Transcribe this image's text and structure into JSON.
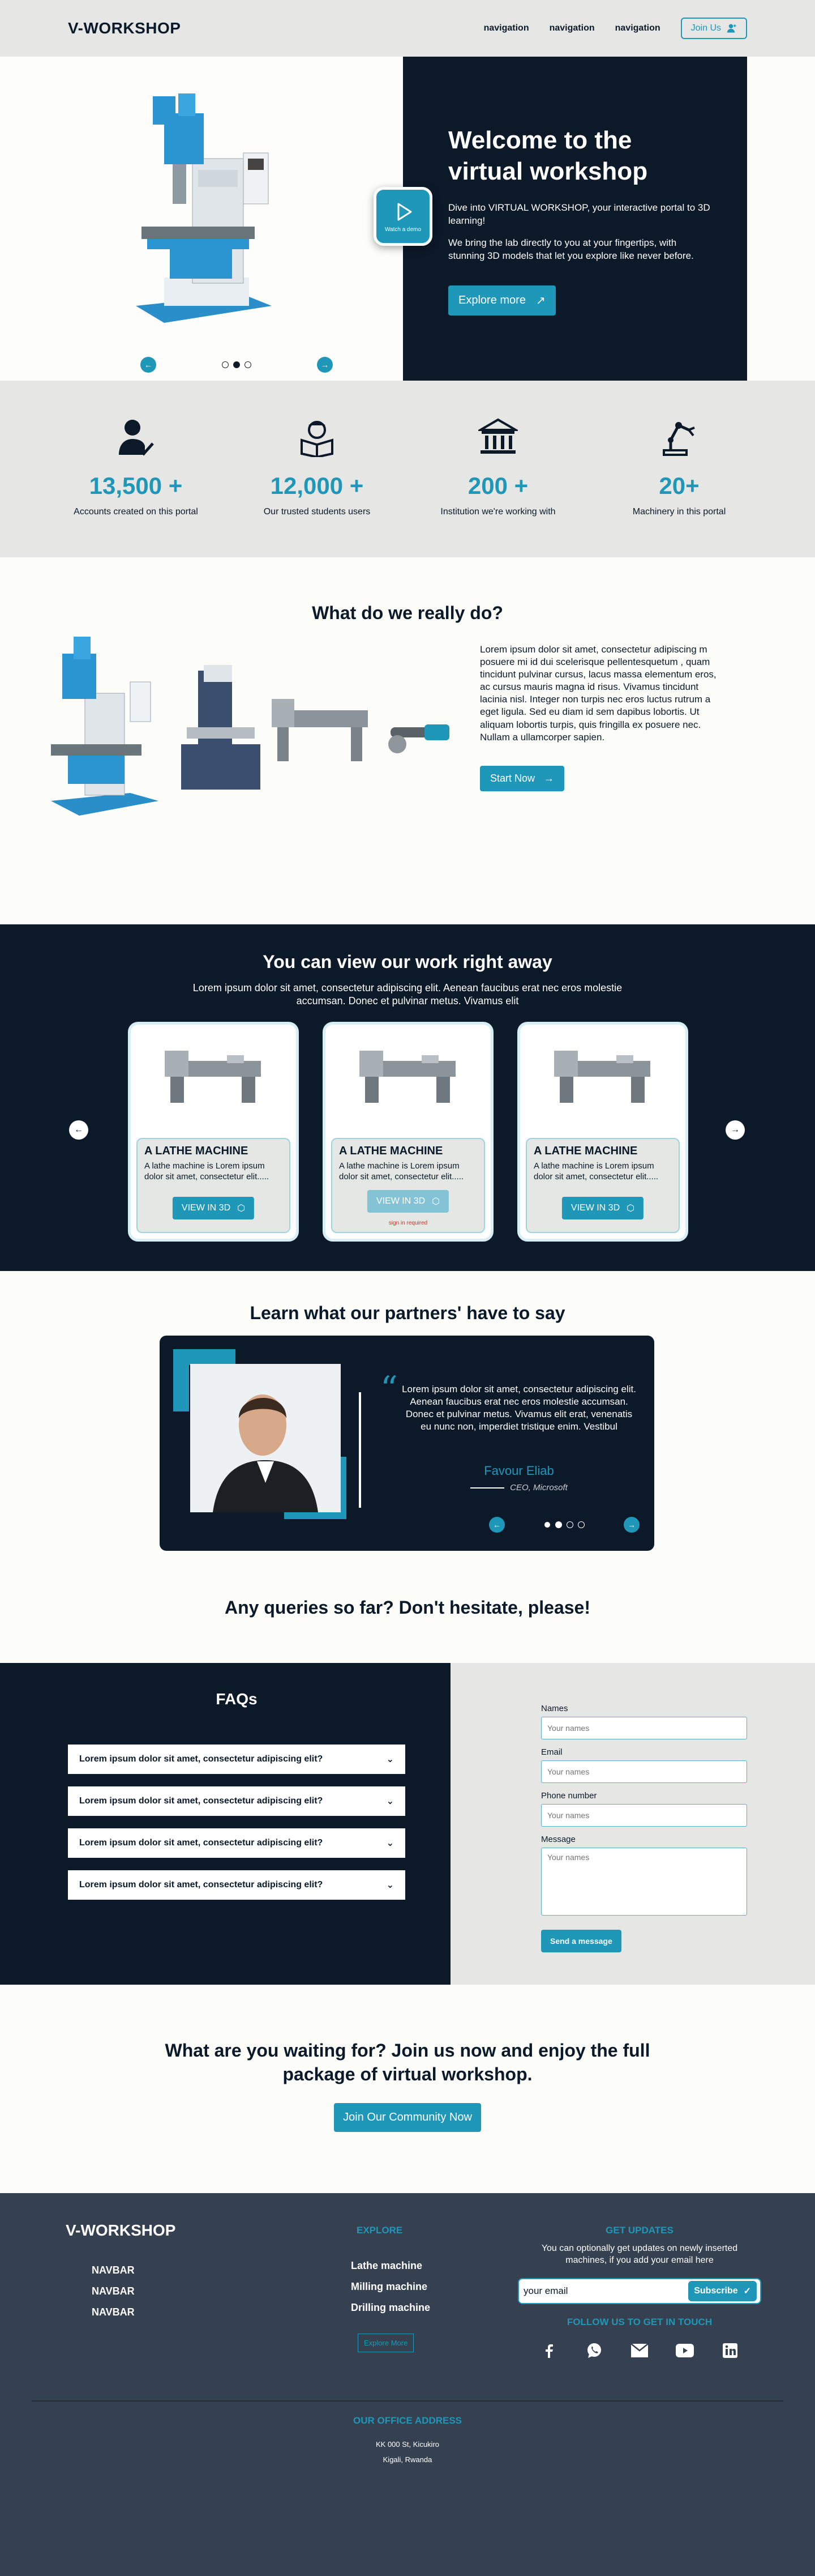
{
  "nav": {
    "brand": "V-WORKSHOP",
    "links": [
      "navigation",
      "navigation",
      "navigation"
    ],
    "join_label": "Join Us",
    "join_icon": "user-plus-icon"
  },
  "hero": {
    "title": "Welcome to the virtual workshop",
    "p1": "Dive into VIRTUAL WORKSHOP, your interactive portal to 3D learning!",
    "p2": "We bring the lab directly to you at your fingertips, with stunning 3D models that let you explore like never before.",
    "explore_label": "Explore more",
    "watch_demo_label": "Watch a demo",
    "carousel_active": 2,
    "carousel_total": 3
  },
  "stats": [
    {
      "icon": "user-check-icon",
      "number": "13,500 +",
      "label": "Accounts  created on this portal"
    },
    {
      "icon": "student-reading-icon",
      "number": "12,000 +",
      "label": "Our trusted students users"
    },
    {
      "icon": "institution-icon",
      "number": "200 +",
      "label": "Institution we're working with"
    },
    {
      "icon": "robotic-arm-icon",
      "number": "20+",
      "label": "Machinery in this portal"
    }
  ],
  "what": {
    "title": "What do we really do?",
    "text": "Lorem ipsum dolor sit amet, consectetur adipiscing m posuere mi id dui scelerisque pellentesquetum , quam tincidunt pulvinar cursus, lacus massa elementum eros, ac cursus mauris magna id risus. Vivamus tincidunt lacinia nisl. Integer non turpis nec eros luctus rutrum a eget ligula. Sed eu diam id sem dapibus lobortis. Ut aliquam lobortis turpis, quis fringilla ex posuere nec. Nullam a ullamcorper sapien.",
    "start_label": "Start Now"
  },
  "work": {
    "title": "You can view our work right away",
    "subtitle": "Lorem ipsum dolor sit amet, consectetur adipiscing elit. Aenean faucibus erat nec eros molestie accumsan. Donec et pulvinar metus. Vivamus elit",
    "cards": [
      {
        "title": "A LATHE MACHINE",
        "desc": "A lathe machine is Lorem ipsum dolor sit amet, consectetur  elit.....",
        "button": "VIEW IN 3D"
      },
      {
        "title": "A LATHE MACHINE",
        "desc": "A lathe machine is Lorem ipsum dolor sit amet, consectetur  elit.....",
        "button": "VIEW IN 3D",
        "note": "sign in required"
      },
      {
        "title": "A LATHE MACHINE",
        "desc": "A lathe machine is Lorem ipsum dolor sit amet, consectetur  elit.....",
        "button": "VIEW IN 3D"
      }
    ]
  },
  "testimonial": {
    "title": "Learn what our partners' have to say",
    "quote": "Lorem ipsum dolor sit amet, consectetur adipiscing elit. Aenean faucibus erat nec eros molestie accumsan. Donec et pulvinar metus. Vivamus elit erat, venenatis eu nunc non, imperdiet tristique enim. Vestibul",
    "name": "Favour Eliab",
    "role": "CEO, Microsoft",
    "active_dot": 2,
    "dot_count": 4
  },
  "queries": {
    "title": "Any queries so far? Don't hesitate, please!"
  },
  "faq": {
    "title": "FAQs",
    "items": [
      "Lorem ipsum dolor sit amet, consectetur adipiscing elit?",
      "Lorem ipsum dolor sit amet, consectetur adipiscing elit?",
      "Lorem ipsum dolor sit amet, consectetur adipiscing elit?",
      "Lorem ipsum dolor sit amet, consectetur adipiscing elit?"
    ]
  },
  "contact": {
    "names_label": "Names",
    "names_ph": "Your names",
    "email_label": "Email",
    "email_ph": "Your names",
    "phone_label": "Phone number",
    "phone_ph": "Your names",
    "message_label": "Message",
    "message_ph": "Your names",
    "send_label": "Send a message"
  },
  "cta": {
    "title": "What are you waiting for? Join us now and enjoy the full package of virtual workshop.",
    "button": "Join Our Community Now"
  },
  "footer": {
    "brand": "V-WORKSHOP",
    "nav": [
      "NAVBAR",
      "NAVBAR",
      "NAVBAR"
    ],
    "explore_heading": "EXPLORE",
    "explore_items": [
      "Lathe machine",
      "Milling machine",
      "Drilling machine"
    ],
    "explore_button": "Explore More",
    "updates_heading": "GET UPDATES",
    "updates_text": "You can optionally get updates on newly inserted machines, if you add your email here",
    "email_value": "your email",
    "subscribe_label": "Subscribe",
    "follow_heading": "FOLLOW US TO GET IN TOUCH",
    "socials": [
      "facebook-icon",
      "whatsapp-icon",
      "mail-icon",
      "youtube-icon",
      "linkedin-icon"
    ],
    "office_heading": "OUR OFFICE ADDRESS",
    "address_line1": "KK 000 St,  Kicukiro",
    "address_line2": "Kigali,  Rwanda"
  },
  "colors": {
    "accent": "#1f97b8",
    "navy": "#0c1929",
    "footer": "#354050",
    "grey": "#e6e6e4"
  }
}
